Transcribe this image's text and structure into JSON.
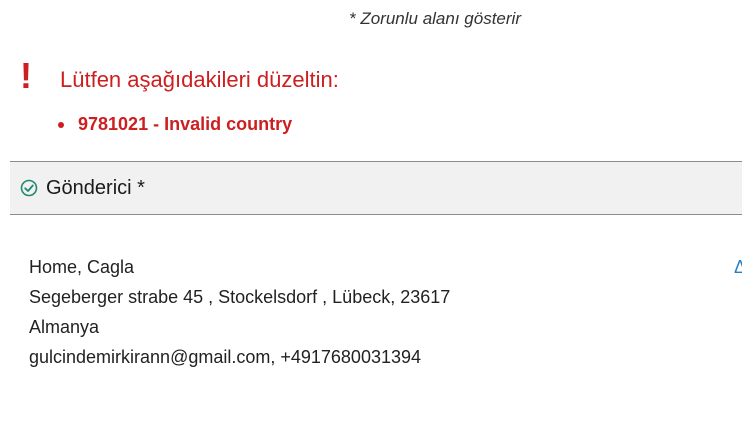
{
  "required_note": "* Zorunlu alanı gösterir",
  "errors": {
    "mark": "!",
    "heading": "Lütfen aşağıdakileri düzeltin:",
    "items": [
      "9781021 - Invalid country"
    ]
  },
  "sender_section": {
    "title": "Gönderici *",
    "icon": "check-circle-icon",
    "edit_label": "Δ"
  },
  "address": {
    "name": "Home, Cagla",
    "street_line": "Segeberger strabe 45 , Stockelsdorf , Lübeck, 23617",
    "country": "Almanya",
    "contact": "gulcindemirkirann@gmail.com, +4917680031394"
  },
  "colors": {
    "error": "#cc1f1f",
    "accent_teal": "#1f8a70",
    "section_bg": "#f1f1f1",
    "link": "#2a7fc4"
  }
}
